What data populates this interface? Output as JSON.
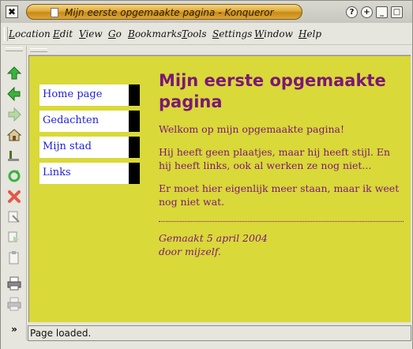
{
  "window": {
    "title": "Mijn eerste opgemaakte pagina - Konqueror"
  },
  "titlebar": {
    "close_glyph": "✖",
    "help_glyph": "?",
    "sticky_glyph": "+",
    "minimize_glyph": "_",
    "maximize_glyph": "□"
  },
  "menubar": {
    "items": [
      "Location",
      "Edit",
      "View",
      "Go",
      "Bookmarks",
      "Tools",
      "Settings",
      "Window",
      "Help"
    ]
  },
  "toolbar": {
    "icons": [
      "up-arrow-icon",
      "back-arrow-icon",
      "forward-arrow-icon",
      "home-icon",
      "reload-icon",
      "refresh-icon",
      "stop-icon",
      "cut-icon",
      "copy-icon",
      "paste-icon",
      "print-icon",
      "print-disabled-icon",
      "more-icon"
    ]
  },
  "page": {
    "nav": [
      "Home page",
      "Gedachten",
      "Mijn stad",
      "Links"
    ],
    "heading": "Mijn eerste opgemaakte pagina",
    "paragraphs": [
      "Welkom op mijn opgemaakte pagina!",
      "Hij heeft geen plaatjes, maar hij heeft stijl. En hij heeft links, ook al werken ze nog niet...",
      "Er moet hier eigenlijk meer staan, maar ik weet nog niet wat."
    ],
    "signature_line1": "Gemaakt 5 april 2004",
    "signature_line2": "door mijzelf."
  },
  "status": {
    "text": "Page loaded."
  },
  "colors": {
    "page_background": "#d9d939",
    "heading": "#7d1677",
    "link": "#1f1fd8"
  }
}
